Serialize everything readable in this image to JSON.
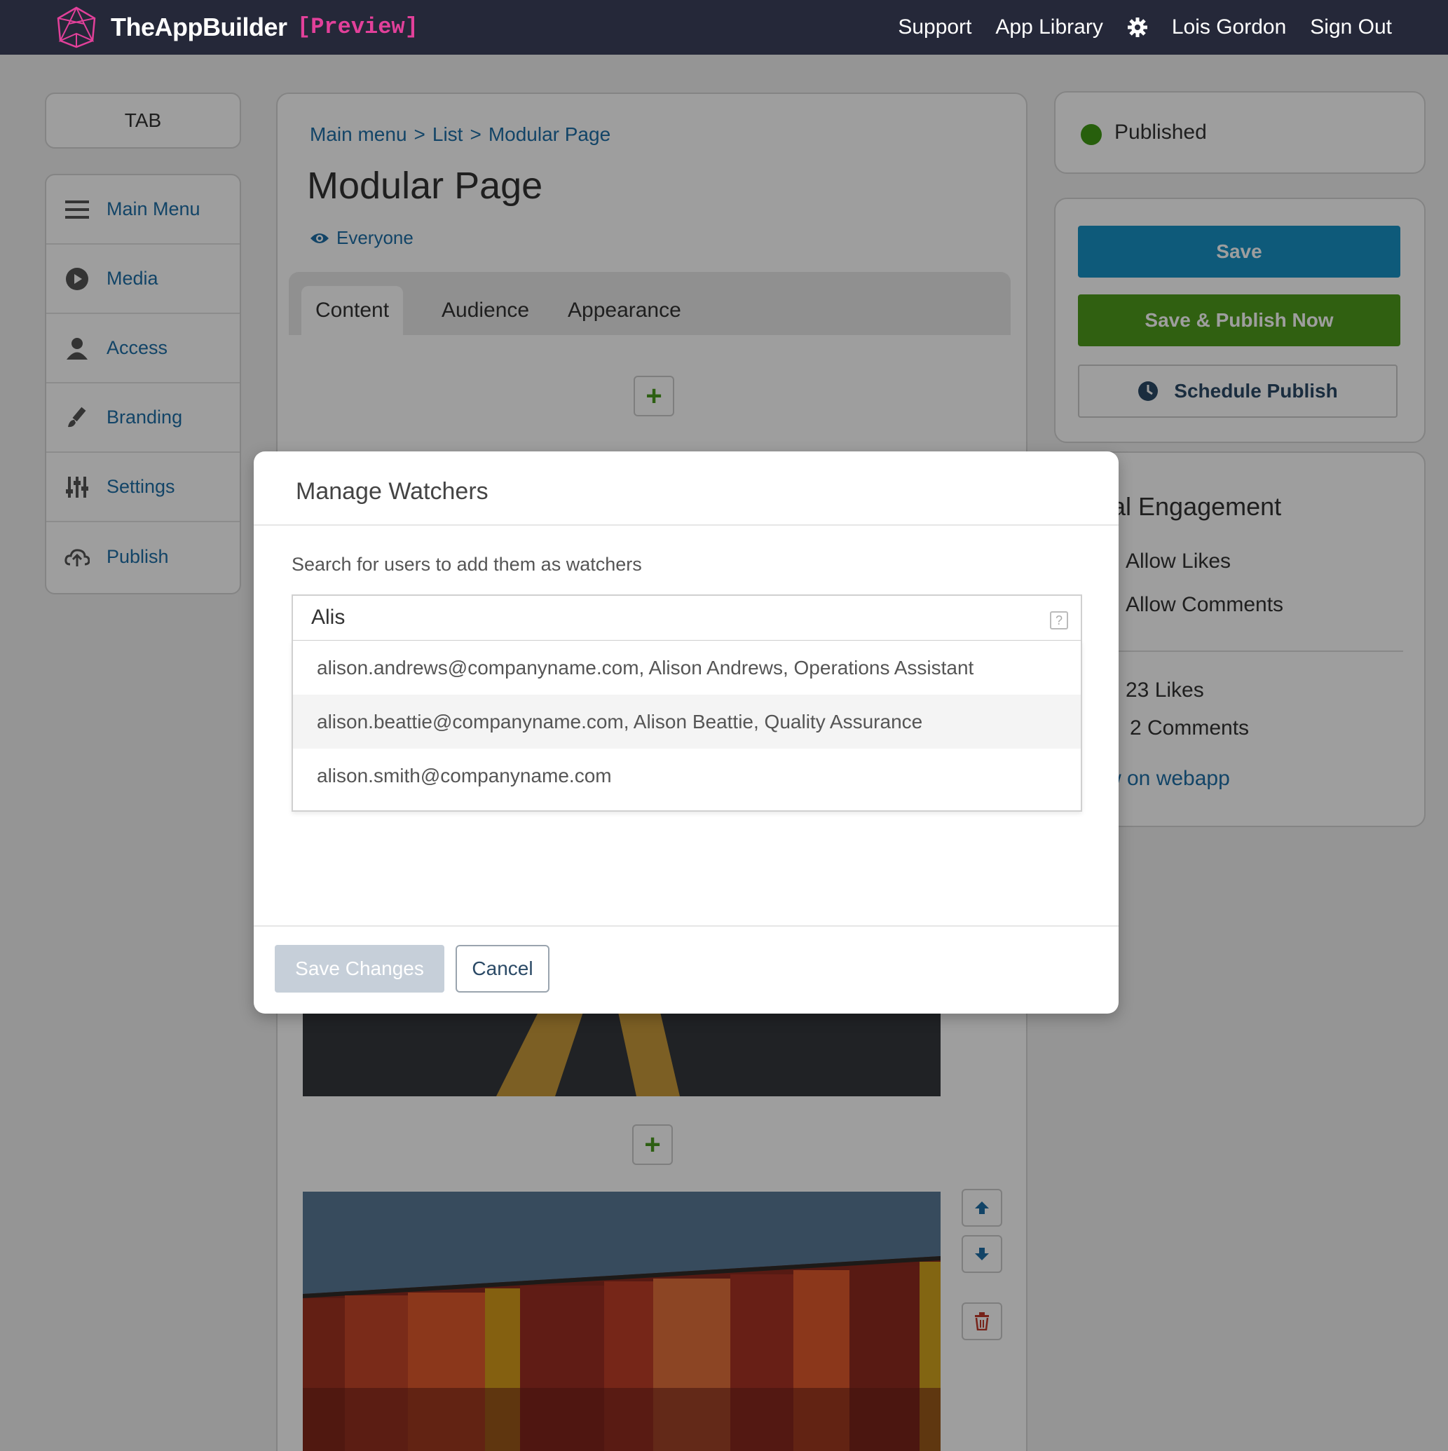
{
  "app": {
    "name_bold": "TheAppBuilder",
    "preview_tag": "[Preview]",
    "nav": [
      "Support",
      "App Library"
    ],
    "user": "Lois Gordon",
    "sign_out": "Sign Out"
  },
  "sidebar": {
    "tab_label": "TAB",
    "items": [
      {
        "label": "Main Menu",
        "icon": "menu-icon"
      },
      {
        "label": "Media",
        "icon": "play-icon"
      },
      {
        "label": "Access",
        "icon": "user-icon"
      },
      {
        "label": "Branding",
        "icon": "brush-icon"
      },
      {
        "label": "Settings",
        "icon": "sliders-icon"
      },
      {
        "label": "Publish",
        "icon": "cloud-upload-icon"
      }
    ]
  },
  "main": {
    "breadcrumb": [
      "Main menu",
      ">",
      "List",
      ">",
      "Modular Page"
    ],
    "title": "Modular Page",
    "audience": "Everyone",
    "tabs": [
      "Content",
      "Audience",
      "Appearance"
    ],
    "active_tab": "Content"
  },
  "right": {
    "status": "Published",
    "status_color": "#3f9a14",
    "save": "Save",
    "save_publish": "Save & Publish Now",
    "schedule": "Schedule Publish",
    "social_title": "ial Engagement",
    "allow_likes": "Allow Likes",
    "allow_comments": "Allow Comments",
    "likes": "23 Likes",
    "comments": "2 Comments",
    "view_link": "w on webapp"
  },
  "modal": {
    "title": "Manage Watchers",
    "hint": "Search for users to add them as watchers",
    "search_value": "Alis",
    "help_glyph": "?",
    "results": [
      "alison.andrews@companyname.com, Alison Andrews, Operations Assistant",
      "alison.beattie@companyname.com, Alison Beattie, Quality Assurance",
      "alison.smith@companyname.com"
    ],
    "save_changes": "Save Changes",
    "cancel": "Cancel"
  },
  "colors": {
    "nav_bg": "#252839",
    "link": "#1e6fa6",
    "save_btn": "#1891c6",
    "publish_btn": "#4e9c1c",
    "preview": "#e2409a"
  }
}
